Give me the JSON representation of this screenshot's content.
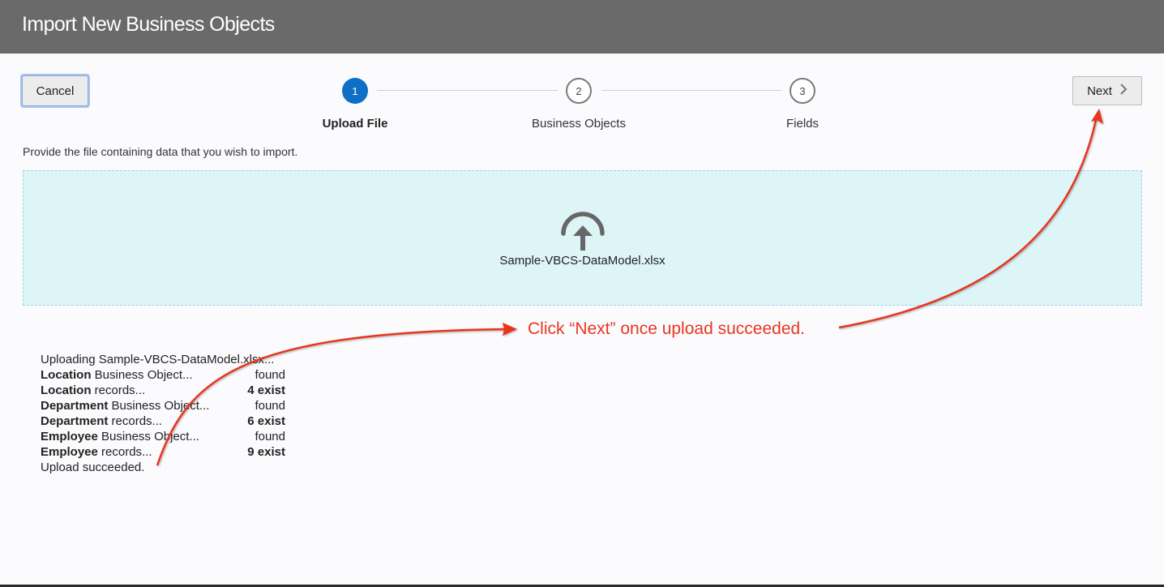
{
  "dialog": {
    "title": "Import New Business Objects"
  },
  "toolbar": {
    "cancel_label": "Cancel",
    "next_label": "Next"
  },
  "steps": [
    {
      "number": "1",
      "label": "Upload File",
      "active": true
    },
    {
      "number": "2",
      "label": "Business Objects",
      "active": false
    },
    {
      "number": "3",
      "label": "Fields",
      "active": false
    }
  ],
  "instruction": "Provide the file containing data that you wish to import.",
  "dropzone": {
    "icon": "upload-icon",
    "filename": "Sample-VBCS-DataModel.xlsx"
  },
  "log": {
    "uploading": "Uploading Sample-VBCS-DataModel.xlsx...",
    "rows": [
      {
        "name": "Location",
        "suffix": " Business Object...",
        "status": "found",
        "status_bold": false
      },
      {
        "name": "Location",
        "suffix": " records...",
        "status": "4 exist",
        "status_bold": true
      },
      {
        "name": "Department",
        "suffix": " Business Object...",
        "status": "found",
        "status_bold": false
      },
      {
        "name": "Department",
        "suffix": " records...",
        "status": "6 exist",
        "status_bold": true
      },
      {
        "name": "Employee",
        "suffix": " Business Object...",
        "status": "found",
        "status_bold": false
      },
      {
        "name": "Employee",
        "suffix": " records...",
        "status": "9 exist",
        "status_bold": true
      }
    ],
    "result": "Upload succeeded."
  },
  "annotation": {
    "text": "Click “Next” once upload succeeded.",
    "color": "#e8361f"
  },
  "colors": {
    "titlebar": "#6a6a6a",
    "accent": "#0f6fc6",
    "dropzone": "#def5f8"
  }
}
